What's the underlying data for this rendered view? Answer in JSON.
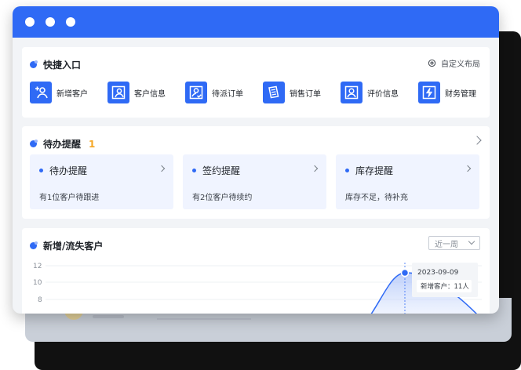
{
  "quick_entry": {
    "title": "快捷入口",
    "custom_layout_label": "自定义布局",
    "items": [
      {
        "label": "新增客户",
        "icon": "add-user-icon"
      },
      {
        "label": "客户信息",
        "icon": "customer-card-icon"
      },
      {
        "label": "待派订单",
        "icon": "pending-order-icon"
      },
      {
        "label": "销售订单",
        "icon": "sales-order-icon"
      },
      {
        "label": "评价信息",
        "icon": "review-icon"
      },
      {
        "label": "财务管理",
        "icon": "finance-icon"
      }
    ]
  },
  "todo": {
    "title": "待办提醒",
    "count": "1",
    "items": [
      {
        "title": "待办提醒",
        "desc": "有1位客户待跟进"
      },
      {
        "title": "签约提醒",
        "desc": "有2位客户待续约"
      },
      {
        "title": "库存提醒",
        "desc": "库存不足，待补充"
      }
    ]
  },
  "trend": {
    "title": "新增/流失客户",
    "range": "近一周",
    "tooltip_date": "2023-09-09",
    "tooltip_value": "新增客户：11人"
  },
  "colors": {
    "accent": "#2f6af5",
    "badge": "#f5a623"
  },
  "chart_data": {
    "type": "area",
    "y_ticks": [
      "12",
      "10",
      "8"
    ],
    "series": [
      {
        "name": "新增客户",
        "points": [
          {
            "x": "2023-09-09",
            "y": 11
          }
        ]
      }
    ]
  }
}
